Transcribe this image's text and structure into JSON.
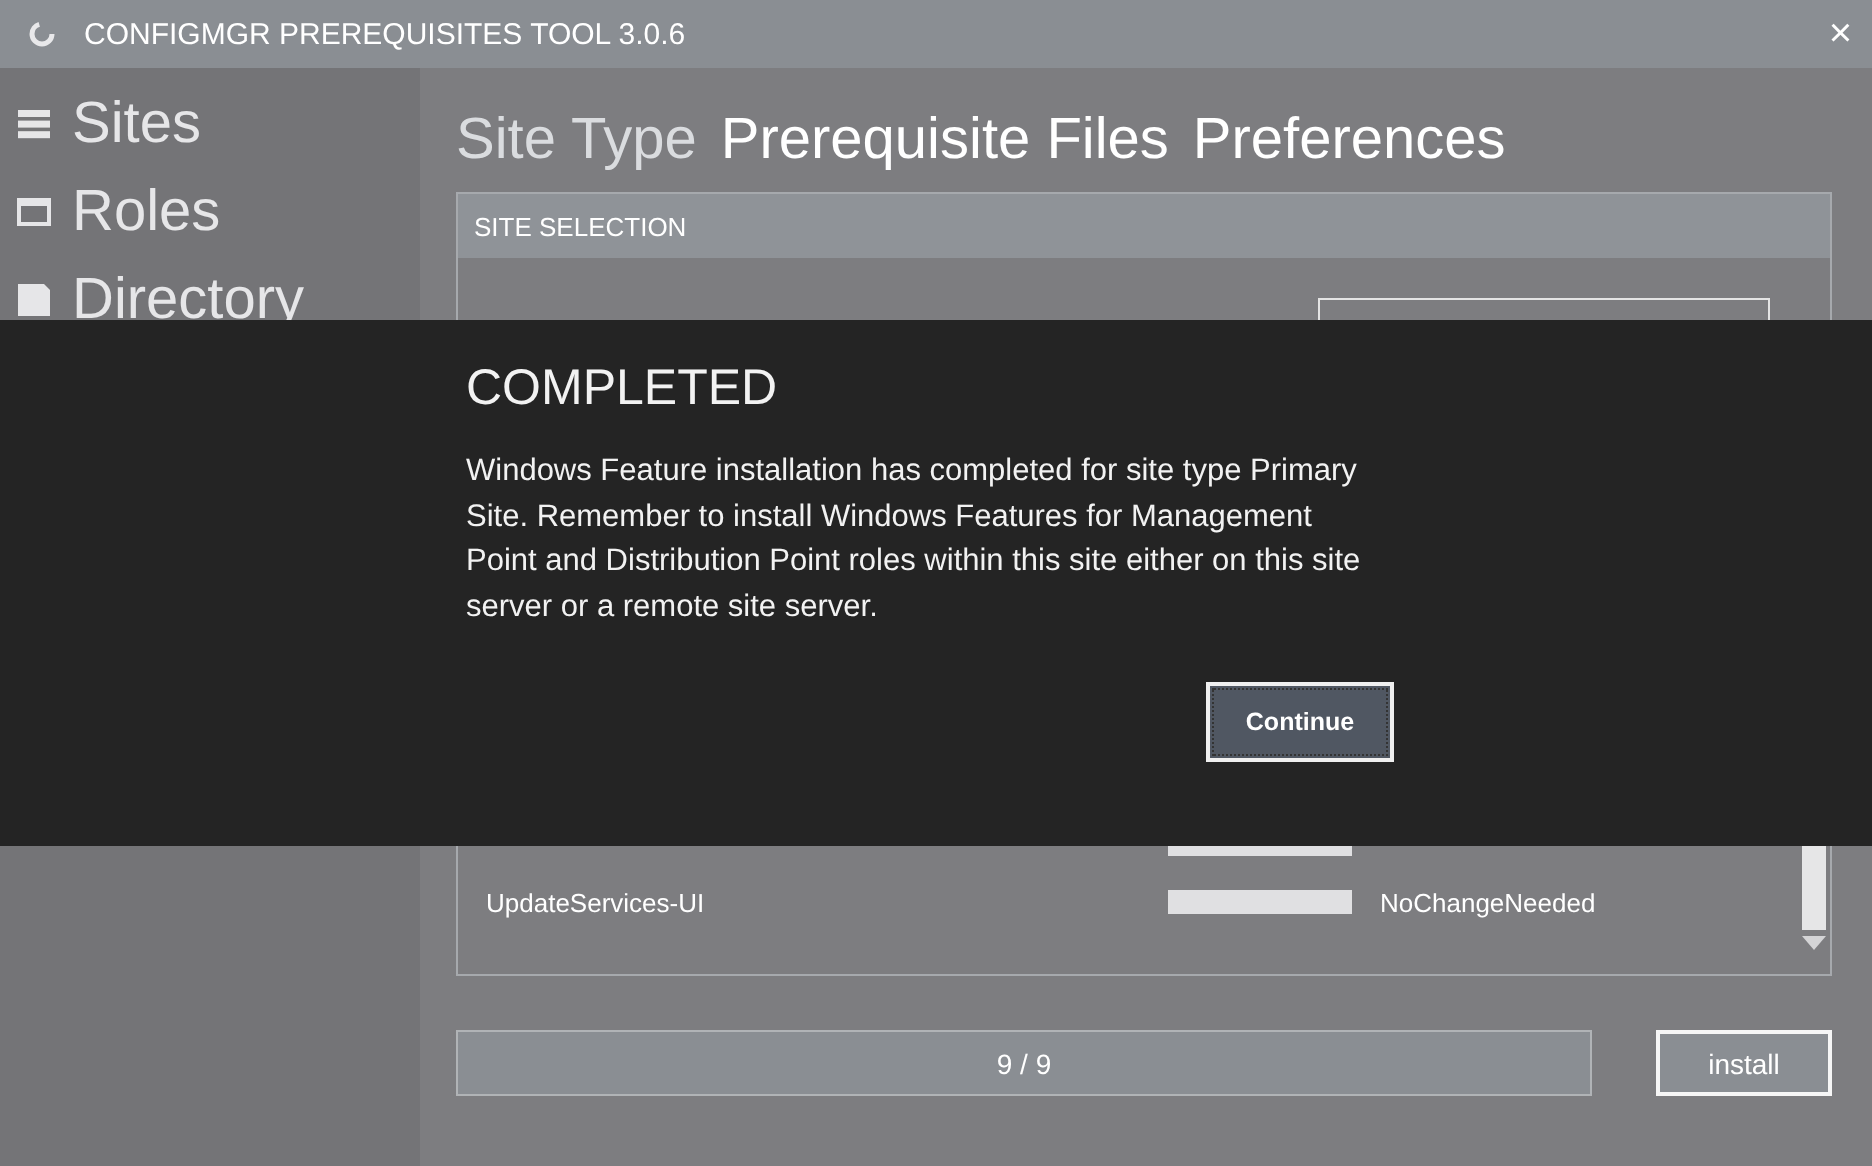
{
  "window": {
    "title": "CONFIGMGR PREREQUISITES TOOL 3.0.6",
    "close": "×"
  },
  "sidebar": {
    "items": [
      {
        "label": "Sites",
        "kind": "list",
        "selected": false
      },
      {
        "label": "Roles",
        "kind": "window",
        "selected": false
      },
      {
        "label": "Directory",
        "kind": "disk",
        "selected": false
      }
    ]
  },
  "tabs": [
    {
      "label": "Site Type",
      "selected": true
    },
    {
      "label": "Prerequisite Files",
      "selected": false
    },
    {
      "label": "Preferences",
      "selected": false
    }
  ],
  "section": {
    "title": "SITE SELECTION",
    "features": [
      {
        "level": 1
      },
      {
        "name": "UpdateServices-UI",
        "level": 1,
        "status": "NoChangeNeeded"
      }
    ]
  },
  "progress": {
    "level": 1,
    "text": "9 / 9"
  },
  "install_button": "install",
  "dialog": {
    "title": "COMPLETED",
    "message": "Windows Feature installation has completed for site type Primary Site. Remember to install Windows Features for Management Point and Distribution Point roles within this site either on this site server or a remote site server.",
    "button": "Continue"
  }
}
